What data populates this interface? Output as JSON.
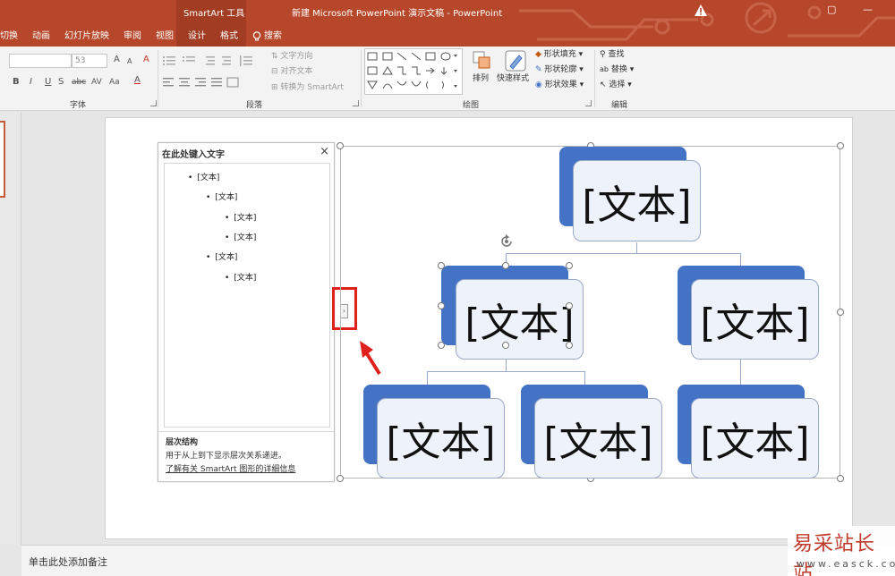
{
  "titlebar": {
    "context_label": "SmartArt 工具",
    "title": "新建 Microsoft PowerPoint 演示文稿 - PowerPoint",
    "restore": "▢",
    "minimize": "—"
  },
  "tabs": [
    {
      "label": "切换"
    },
    {
      "label": "动画"
    },
    {
      "label": "幻灯片放映"
    },
    {
      "label": "审阅"
    },
    {
      "label": "视图"
    },
    {
      "label": "设计"
    },
    {
      "label": "格式"
    },
    {
      "label": "搜索"
    }
  ],
  "ribbon": {
    "font": {
      "group_label": "字体",
      "font_size": "53",
      "grow": "A",
      "shrink": "A",
      "clear": "A",
      "bold": "B",
      "italic": "I",
      "underline": "U",
      "shadow": "S",
      "strike": "abc",
      "spacing": "AV",
      "case": "Aa",
      "color": "A"
    },
    "paragraph": {
      "group_label": "段落",
      "text_direction": "文字方向",
      "align_text": "对齐文本",
      "convert_smartart": "转换为 SmartArt"
    },
    "drawing": {
      "group_label": "绘图",
      "arrange": "排列",
      "quick_styles": "快速样式",
      "shape_fill": "形状填充",
      "shape_outline": "形状轮廓",
      "shape_effects": "形状效果"
    },
    "editing": {
      "group_label": "编辑",
      "find": "查找",
      "replace": "替换",
      "select": "选择"
    }
  },
  "text_pane": {
    "title": "在此处键入文字",
    "close": "×",
    "items": [
      {
        "text": "[文本]"
      },
      {
        "text": "[文本]"
      },
      {
        "text": "[文本]"
      },
      {
        "text": "[文本]"
      },
      {
        "text": "[文本]"
      },
      {
        "text": "[文本]"
      }
    ],
    "info_title": "层次结构",
    "info_desc": "用于从上到下显示层次关系递进。",
    "info_link": "了解有关 SmartArt 图形的详细信息",
    "toggle_glyph": "›"
  },
  "smartart": {
    "nodes": [
      {
        "text": "[文本]"
      },
      {
        "text": "[文本]"
      },
      {
        "text": "[文本]"
      },
      {
        "text": "[文本]"
      },
      {
        "text": "[文本]"
      },
      {
        "text": "[文本]"
      }
    ],
    "accent": "#4472c4"
  },
  "notes": {
    "placeholder": "单击此处添加备注"
  },
  "watermark": {
    "name": "易采站长站",
    "url": "www.easck.com"
  }
}
